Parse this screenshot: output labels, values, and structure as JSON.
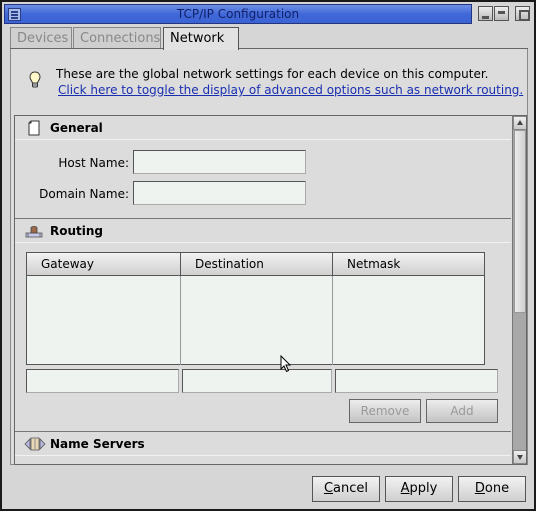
{
  "window": {
    "title": "TCP/IP Configuration",
    "controls": [
      "window-menu-icon",
      "shade-icon",
      "minimize-icon",
      "maximize-icon"
    ]
  },
  "tabs": [
    {
      "label": "Devices",
      "active": false
    },
    {
      "label": "Connections",
      "active": false
    },
    {
      "label": "Network",
      "active": true
    }
  ],
  "info": {
    "icon": "lightbulb-icon",
    "text": "These are the global network settings for each device on this computer.",
    "link": "Click here to toggle the display of advanced options such as network routing."
  },
  "sections": {
    "general": {
      "title": "General",
      "icon": "document-icon",
      "host_name_label": "Host Name:",
      "host_name_value": "",
      "domain_name_label": "Domain Name:",
      "domain_name_value": ""
    },
    "routing": {
      "title": "Routing",
      "icon": "routing-icon",
      "columns": [
        "Gateway",
        "Destination",
        "Netmask"
      ],
      "rows": [],
      "gateway_input": "",
      "destination_input": "",
      "netmask_input": "",
      "remove_label": "Remove",
      "add_label": "Add"
    },
    "name_servers": {
      "title": "Name Servers",
      "icon": "name-servers-icon"
    }
  },
  "footer": {
    "cancel_label": "Cancel",
    "cancel_mnemonic": "C",
    "cancel_rest": "ancel",
    "apply_label": "Apply",
    "apply_mnemonic": "A",
    "apply_rest": "pply",
    "done_label": "Done",
    "done_mnemonic": "D",
    "done_rest": "one"
  },
  "colors": {
    "titlebar": "#4168d8",
    "link": "#1a2fb0",
    "input_bg": "#eff3f0",
    "panel_bg": "#dcdcdc"
  }
}
